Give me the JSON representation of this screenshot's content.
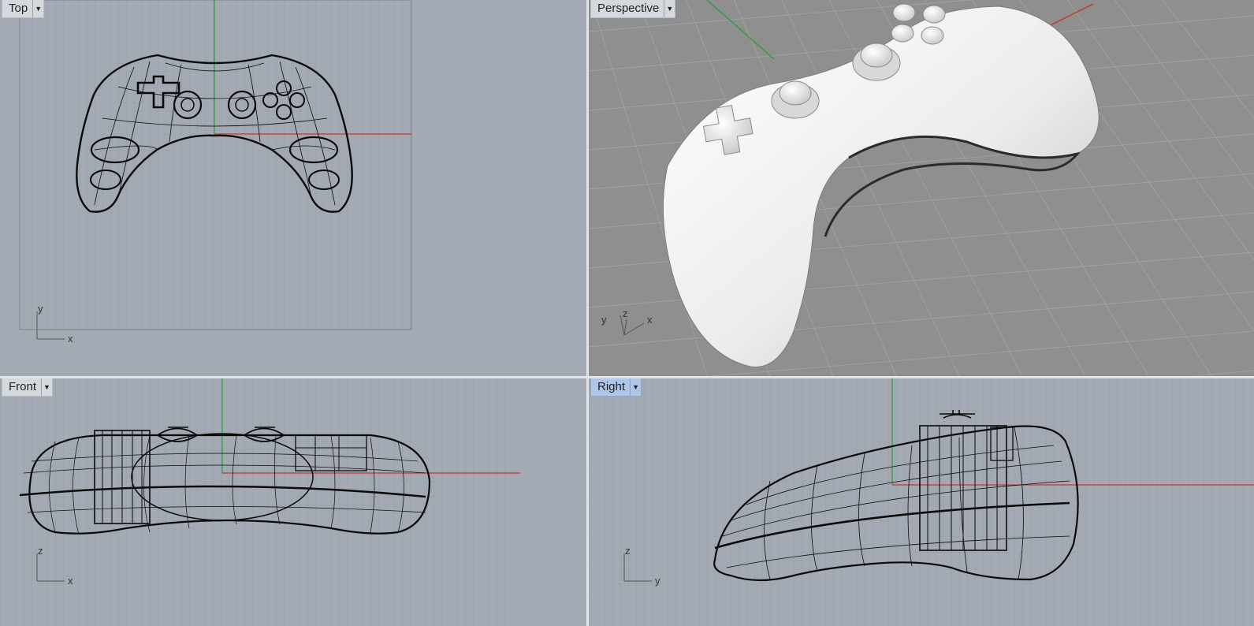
{
  "viewports": {
    "top": {
      "label": "Top",
      "active": false,
      "axes": {
        "x": "x",
        "y": "y"
      }
    },
    "perspective": {
      "label": "Perspective",
      "active": false,
      "axes": {
        "x": "x",
        "y": "y",
        "z": "z"
      }
    },
    "front": {
      "label": "Front",
      "active": false,
      "axes": {
        "x": "x",
        "z": "z"
      }
    },
    "right": {
      "label": "Right",
      "active": true,
      "axes": {
        "y": "y",
        "z": "z"
      }
    }
  },
  "colors": {
    "viewport_bg": "#a3aab3",
    "perspective_bg": "#8f8f8f",
    "grid_minor": "#8e96a0",
    "grid_major": "#7c848d",
    "x_axis": "#c0392b",
    "y_axis": "#2ea043",
    "wire": "#0a0a0a",
    "active_tab": "#aec7e8"
  },
  "icons": {
    "tab_menu": "triangle-down-icon"
  }
}
